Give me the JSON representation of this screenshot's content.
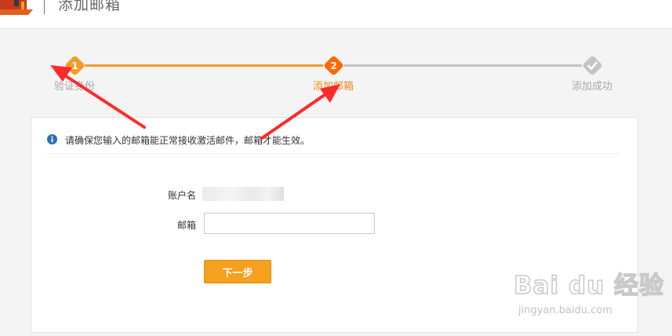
{
  "header": {
    "title": "添加邮箱"
  },
  "steps": [
    {
      "number": "1",
      "label": "验证身份"
    },
    {
      "number": "2",
      "label": "添加邮箱"
    },
    {
      "number": "",
      "label": "添加成功"
    }
  ],
  "notice": {
    "icon": "info-icon",
    "text": "请确保您输入的邮箱能正常接收激活邮件，邮箱才能生效。"
  },
  "form": {
    "account_label": "账户名",
    "account_value": "",
    "email_label": "邮箱",
    "email_value": "",
    "email_placeholder": "",
    "next_label": "下一步"
  },
  "watermark": {
    "main": "Bai du 经验",
    "sub": "jingyan.baidu.com"
  },
  "colors": {
    "accent": "#f59b2b",
    "active_step": "#ff6a00",
    "inactive": "#c4c4c4",
    "info": "#2a6fb6"
  }
}
